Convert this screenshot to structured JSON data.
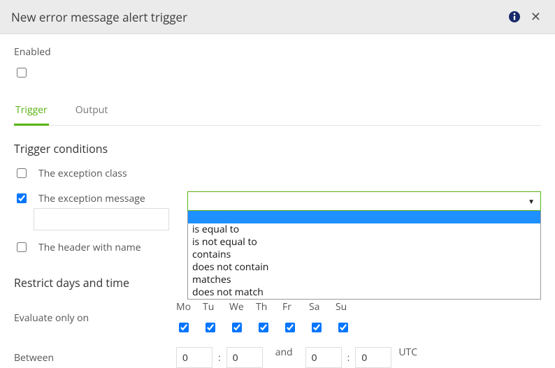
{
  "header": {
    "title": "New error message alert trigger"
  },
  "enabled": {
    "label": "Enabled",
    "checked": false
  },
  "tabs": {
    "trigger": "Trigger",
    "output": "Output"
  },
  "sections": {
    "conditions_title": "Trigger conditions",
    "restrict_title": "Restrict days and time"
  },
  "conditions": {
    "exception_class": {
      "label": "The exception class",
      "checked": false
    },
    "exception_message": {
      "label": "The exception message",
      "checked": true,
      "value": ""
    },
    "header_name": {
      "label": "The header with name",
      "checked": false
    }
  },
  "operator_select": {
    "selected": "",
    "options": {
      "blank": "",
      "eq": "is equal to",
      "neq": "is not equal to",
      "contains": "contains",
      "ncontains": "does not contain",
      "matches": "matches",
      "nmatches": "does not match"
    }
  },
  "restrict": {
    "evaluate_label": "Evaluate only on",
    "days": {
      "mo": "Mo",
      "tu": "Tu",
      "we": "We",
      "th": "Th",
      "fr": "Fr",
      "sa": "Sa",
      "su": "Su"
    },
    "days_checked": {
      "mo": true,
      "tu": true,
      "we": true,
      "th": true,
      "fr": true,
      "sa": true,
      "su": true
    },
    "between_label": "Between",
    "and_label": "and",
    "utc_label": "UTC",
    "from_h": "0",
    "from_m": "0",
    "to_h": "0",
    "to_m": "0",
    "colon": ":"
  }
}
